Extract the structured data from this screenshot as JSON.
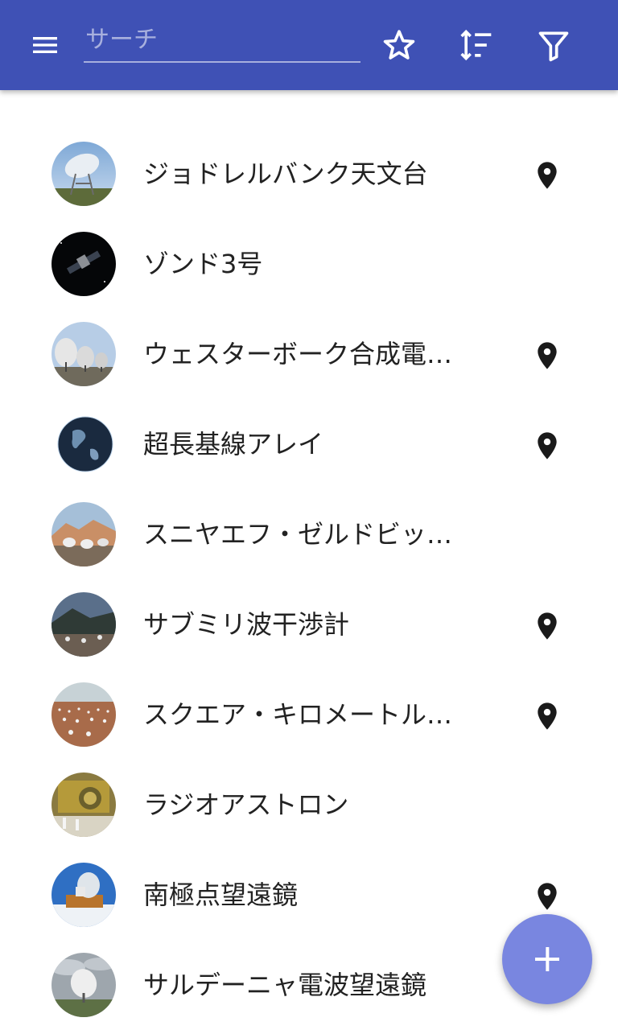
{
  "toolbar": {
    "background": "#3f51b5",
    "menu_icon": "menu-icon",
    "search": {
      "placeholder": "サーチ",
      "value": ""
    },
    "actions": [
      {
        "icon": "star-outline-icon"
      },
      {
        "icon": "sort-icon"
      },
      {
        "icon": "filter-icon"
      }
    ]
  },
  "list": {
    "items": [
      {
        "label": "ジョドレルバンク天文台",
        "has_location": true,
        "avatar_icon": "radio-dish-photo"
      },
      {
        "label": "ゾンド3号",
        "has_location": false,
        "avatar_icon": "spacecraft-photo"
      },
      {
        "label": "ウェスターボーク合成電波望遠鏡",
        "has_location": true,
        "avatar_icon": "dish-array-photo"
      },
      {
        "label": "超長基線アレイ",
        "has_location": true,
        "avatar_icon": "globe-photo"
      },
      {
        "label": "スニヤエフ・ゼルドビッチ配列",
        "has_location": false,
        "avatar_icon": "mountain-array-photo"
      },
      {
        "label": "サブミリ波干渉計",
        "has_location": true,
        "avatar_icon": "mountain-observatory-photo"
      },
      {
        "label": "スクエア・キロメートル・アレイ",
        "has_location": true,
        "avatar_icon": "desert-array-photo"
      },
      {
        "label": "ラジオアストロン",
        "has_location": false,
        "avatar_icon": "satellite-assembly-photo"
      },
      {
        "label": "南極点望遠鏡",
        "has_location": true,
        "avatar_icon": "south-pole-telescope-photo"
      },
      {
        "label": "サルデーニャ電波望遠鏡",
        "has_location": false,
        "avatar_icon": "cloudy-dish-photo"
      }
    ]
  },
  "fab": {
    "icon": "add-icon",
    "color": "#7986e0"
  },
  "colors": {
    "accent": "#3f51b5",
    "text": "#222222",
    "pin": "#1a1a1a"
  }
}
